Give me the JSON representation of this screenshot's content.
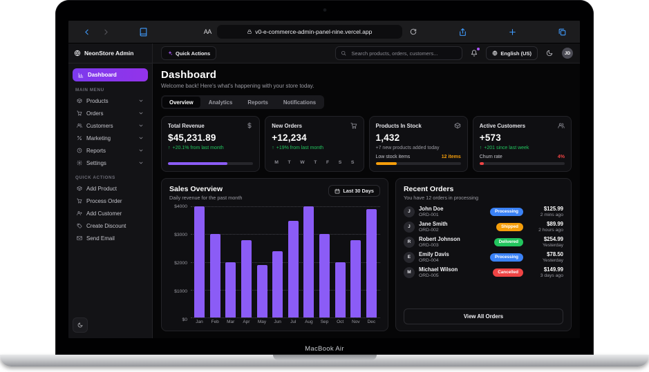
{
  "laptop": {
    "label": "MacBook Air"
  },
  "browser": {
    "url": "v0-e-commerce-admin-panel-nine.vercel.app",
    "reader_label": "AA"
  },
  "app": {
    "brand": "NeonStore Admin",
    "header": {
      "quick_actions_label": "Quick Actions",
      "search_placeholder": "Search products, orders, customers...",
      "language_label": "English (US)",
      "avatar_initials": "JD"
    },
    "sidebar": {
      "active_item": "Dashboard",
      "main_menu_label": "MAIN MENU",
      "menu": [
        "Products",
        "Orders",
        "Customers",
        "Marketing",
        "Reports",
        "Settings"
      ],
      "quick_actions_label": "QUICK ACTIONS",
      "quick_actions": [
        "Add Product",
        "Process Order",
        "Add Customer",
        "Create Discount",
        "Send Email"
      ]
    },
    "page": {
      "title": "Dashboard",
      "subtitle": "Welcome back! Here's what's happening with your store today.",
      "tabs": [
        "Overview",
        "Analytics",
        "Reports",
        "Notifications"
      ],
      "active_tab": "Overview"
    },
    "stats": [
      {
        "title": "Total Revenue",
        "icon": "dollar-icon",
        "value": "$45,231.89",
        "change": "+20.1% from last month",
        "progress_pct": 70,
        "bar_color": "#8b5cf6"
      },
      {
        "title": "New Orders",
        "icon": "cart-icon",
        "value": "+12,234",
        "change": "+19% from last month",
        "days": [
          "M",
          "T",
          "W",
          "T",
          "F",
          "S",
          "S"
        ]
      },
      {
        "title": "Products In Stock",
        "icon": "box-icon",
        "value": "1,432",
        "note": "+7 new products added today",
        "meta_label": "Low stock items",
        "meta_value": "12 items",
        "progress_pct": 25,
        "bar_color": "#f59e0b"
      },
      {
        "title": "Active Customers",
        "icon": "users-icon",
        "value": "+573",
        "change": "+201 since last week",
        "meta_label": "Churn rate",
        "meta_value": "4%",
        "progress_pct": 5,
        "bar_color": "#ef4444"
      }
    ],
    "sales": {
      "title": "Sales Overview",
      "subtitle": "Daily revenue for the past month",
      "range_button": "Last 30 Days"
    },
    "orders": {
      "title": "Recent Orders",
      "subtitle": "You have 12 orders in processing",
      "items": [
        {
          "initial": "J",
          "name": "John Doe",
          "id": "ORD-001",
          "status": "Processing",
          "amount": "$125.99",
          "time": "2 mins ago"
        },
        {
          "initial": "J",
          "name": "Jane Smith",
          "id": "ORD-002",
          "status": "Shipped",
          "amount": "$89.99",
          "time": "2 hours ago"
        },
        {
          "initial": "R",
          "name": "Robert Johnson",
          "id": "ORD-003",
          "status": "Delivered",
          "amount": "$254.99",
          "time": "Yesterday"
        },
        {
          "initial": "E",
          "name": "Emily Davis",
          "id": "ORD-004",
          "status": "Processing",
          "amount": "$78.50",
          "time": "Yesterday"
        },
        {
          "initial": "M",
          "name": "Michael Wilson",
          "id": "ORD-005",
          "status": "Cancelled",
          "amount": "$149.99",
          "time": "3 days ago"
        }
      ],
      "view_all_label": "View All Orders"
    }
  },
  "chart_data": {
    "type": "bar",
    "title": "Sales Overview",
    "xlabel": "",
    "ylabel": "Daily revenue",
    "categories": [
      "Jan",
      "Feb",
      "Mar",
      "Apr",
      "May",
      "Jun",
      "Jul",
      "Aug",
      "Sep",
      "Oct",
      "Nov",
      "Dec"
    ],
    "values": [
      4000,
      3000,
      2000,
      2780,
      1890,
      2390,
      3490,
      4000,
      3000,
      2000,
      2780,
      3890
    ],
    "ylim": [
      0,
      4000
    ],
    "yticks": [
      "$4000",
      "$3000",
      "$2000",
      "$1000",
      "$0"
    ],
    "grid": "dotted-horizontal",
    "legend": "none",
    "bar_color": "#8b5cf6"
  },
  "colors": {
    "accent": "#8b5cf6",
    "positive": "#22c55e",
    "warning": "#f59e0b",
    "negative": "#ef4444",
    "status": {
      "processing": "#3b82f6",
      "shipped": "#f59e0b",
      "delivered": "#22c55e",
      "cancelled": "#ef4444"
    }
  }
}
